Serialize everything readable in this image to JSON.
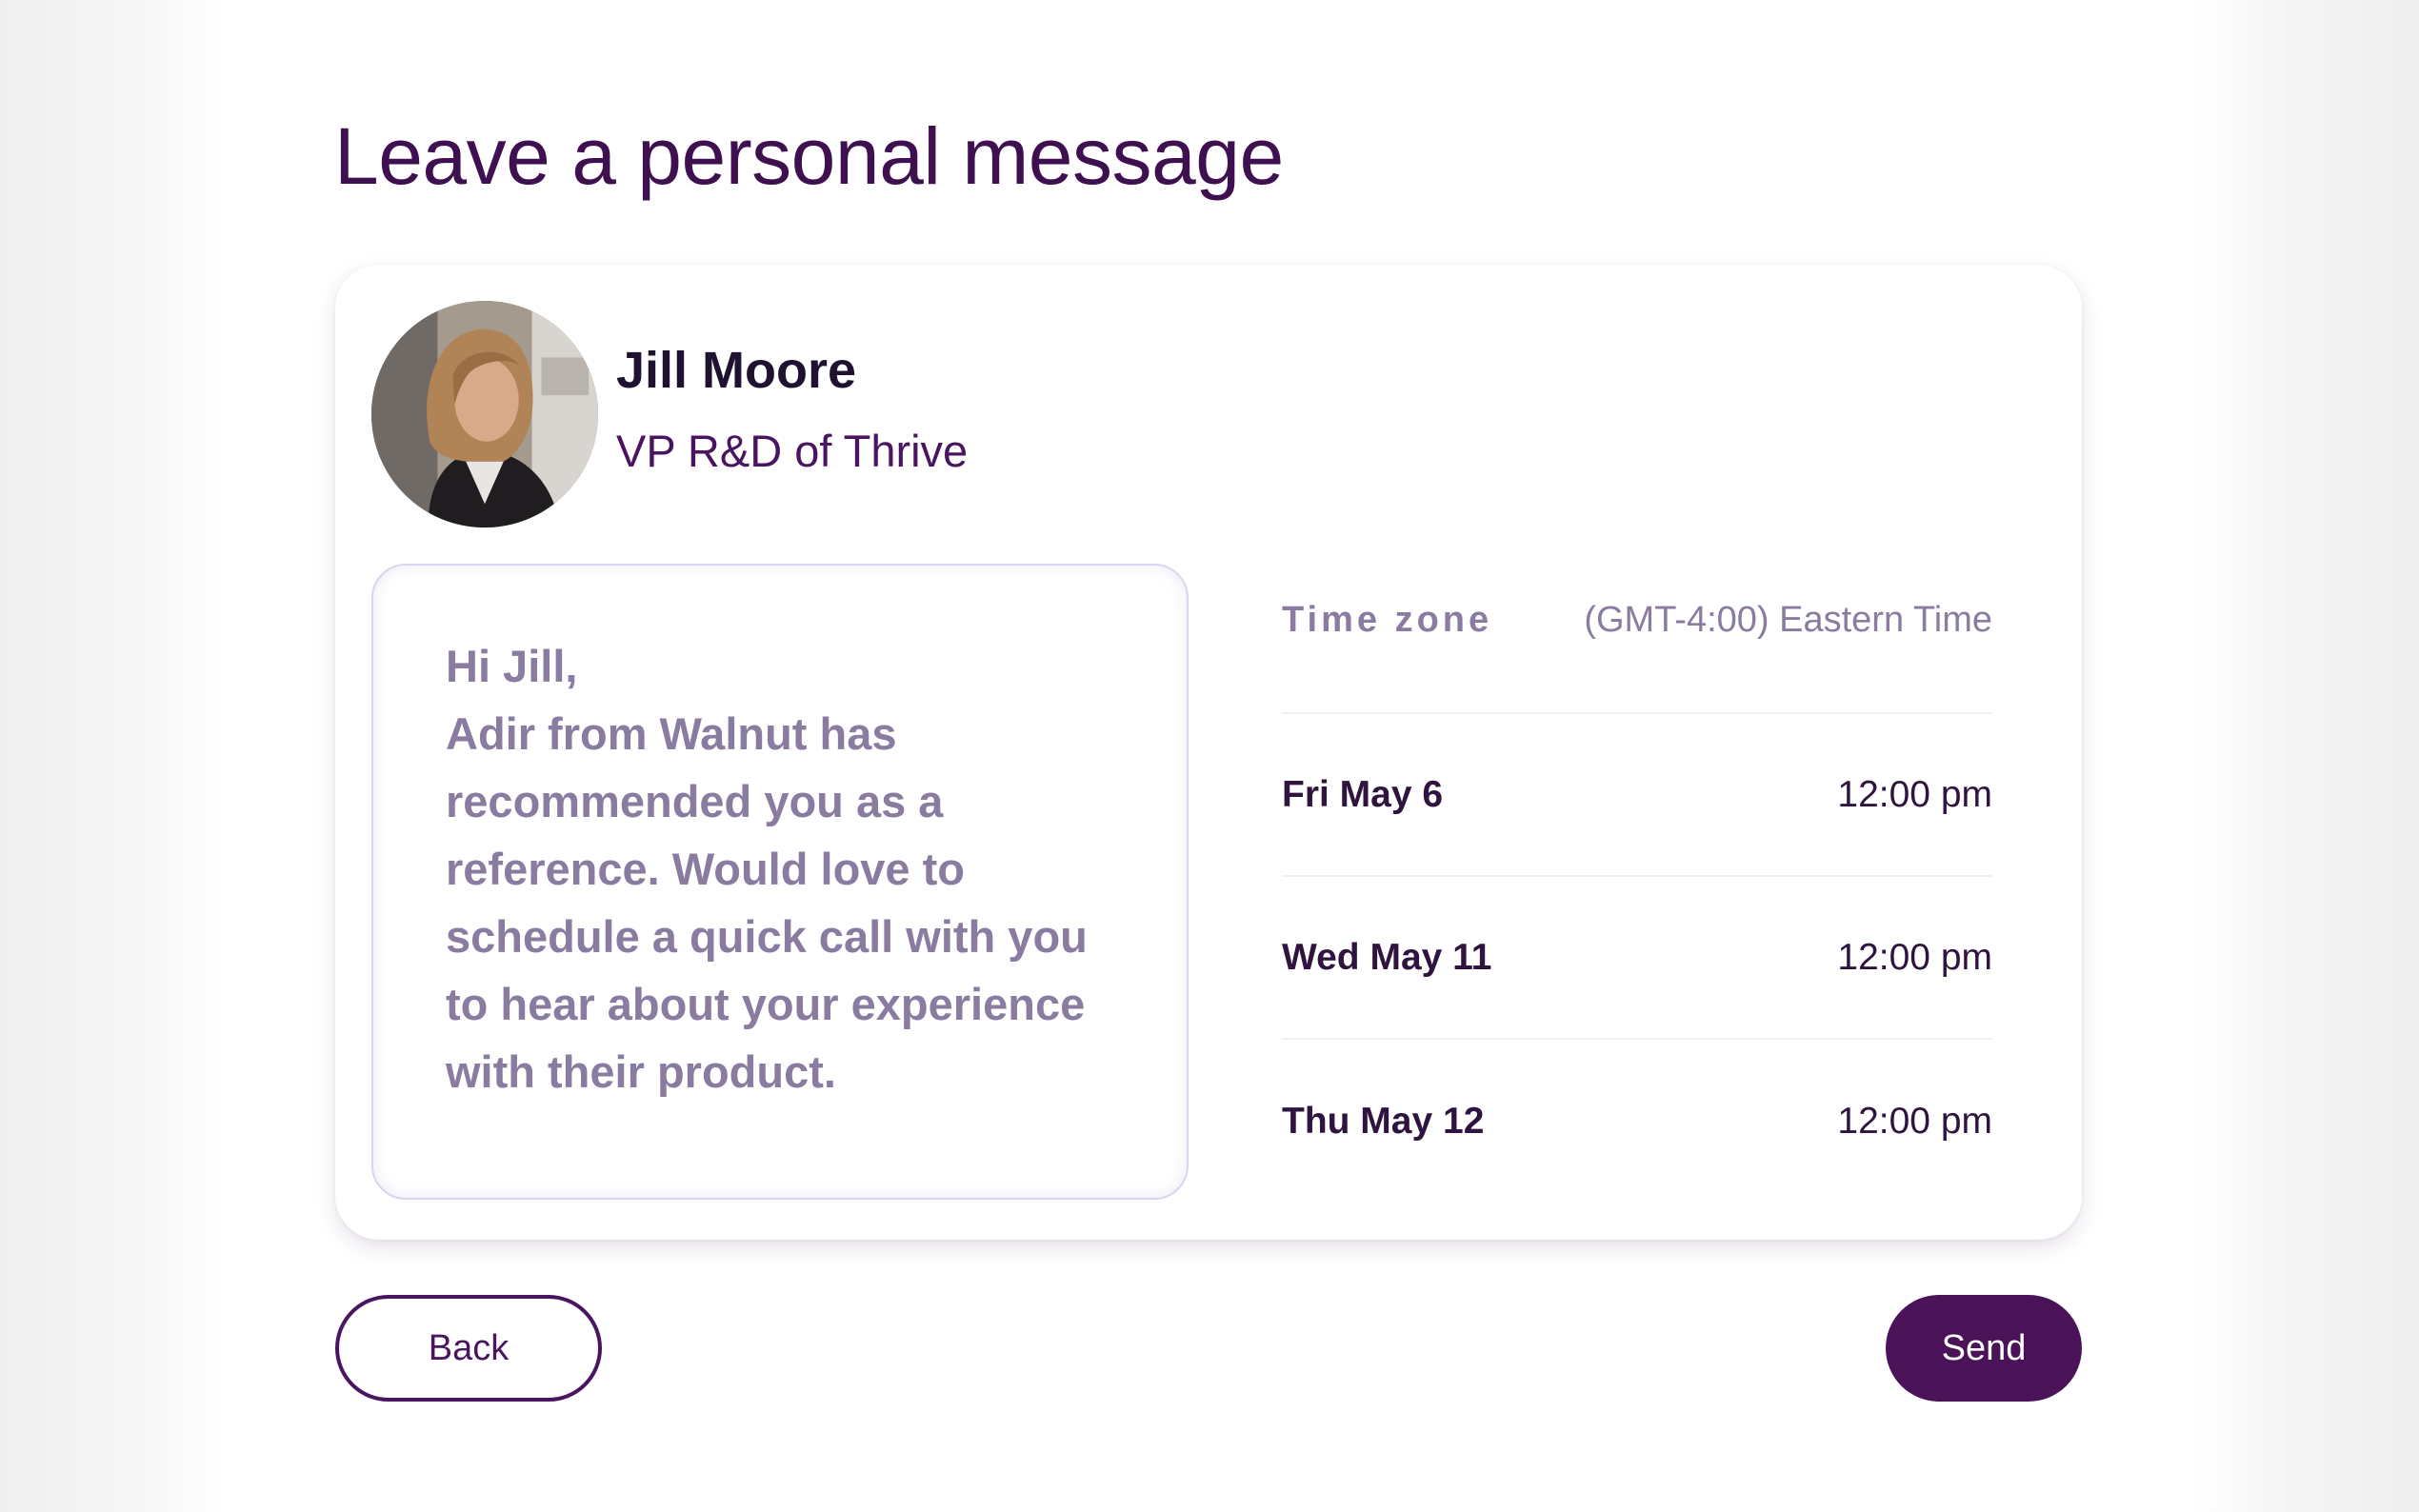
{
  "page": {
    "title": "Leave a personal message"
  },
  "contact": {
    "name": "Jill Moore",
    "role": "VP R&D of Thrive"
  },
  "message": {
    "lines": [
      "Hi Jill,",
      "Adir from Walnut has",
      "recommended you as a",
      "reference. Would love to",
      "schedule a quick call with you",
      "to hear about your experience",
      "with their product."
    ]
  },
  "schedule": {
    "timezone_label": "Time zone",
    "timezone_value": "(GMT-4:00) Eastern Time",
    "slots": [
      {
        "date": "Fri May 6",
        "time": "12:00 pm"
      },
      {
        "date": "Wed May 11",
        "time": "12:00 pm"
      },
      {
        "date": "Thu May 12",
        "time": "12:00 pm"
      }
    ]
  },
  "actions": {
    "back_label": "Back",
    "send_label": "Send"
  },
  "colors": {
    "brand": "#4a1358",
    "title": "#3f1050",
    "muted_text": "#8a7ba0"
  }
}
